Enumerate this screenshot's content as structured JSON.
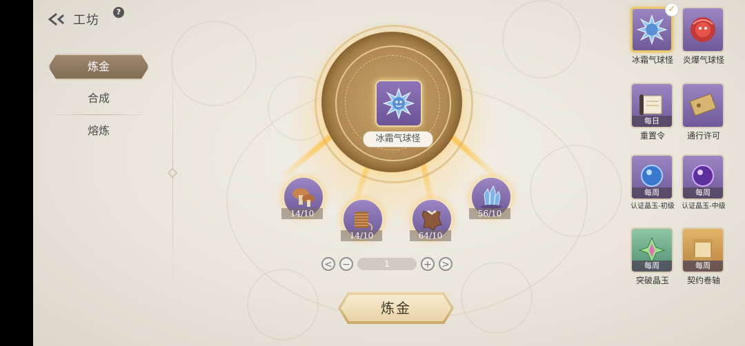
{
  "header": {
    "title": "工坊",
    "help_icon": "question-icon",
    "back_icon": "back-arrow-icon"
  },
  "menu": {
    "items": [
      {
        "label": "炼金",
        "active": true
      },
      {
        "label": "合成",
        "active": false
      },
      {
        "label": "熔炼",
        "active": false
      }
    ]
  },
  "recipe": {
    "target_label": "冰霜气球怪",
    "target_icon": "ice-balloon-monster-icon",
    "materials": [
      {
        "name": "mushroom-material",
        "count": "14/10"
      },
      {
        "name": "thread-spool-material",
        "count": "14/10"
      },
      {
        "name": "leather-hide-material",
        "count": "64/10"
      },
      {
        "name": "crystal-cluster-material",
        "count": "56/10"
      }
    ]
  },
  "quantity": {
    "value": "1",
    "prev": "<",
    "minus": "−",
    "plus": "+",
    "next": ">"
  },
  "craft_button": {
    "label": "炼金"
  },
  "side_items": [
    {
      "label": "冰霜气球怪",
      "tag": "",
      "icon": "ice-balloon-monster-icon",
      "selected": true
    },
    {
      "label": "炎爆气球怪",
      "tag": "",
      "icon": "fire-balloon-monster-icon",
      "selected": false
    },
    {
      "label": "重置令",
      "tag": "每日",
      "icon": "reset-scroll-icon",
      "selected": false
    },
    {
      "label": "通行许可",
      "tag": "",
      "icon": "pass-permit-icon",
      "selected": false
    },
    {
      "label": "认证晶玉-初级",
      "tag": "每周",
      "icon": "blue-orb-icon",
      "selected": false
    },
    {
      "label": "认证晶玉-中级",
      "tag": "每周",
      "icon": "purple-orb-icon",
      "selected": false
    },
    {
      "label": "突破晶玉",
      "tag": "每周",
      "icon": "breakthrough-crystal-icon",
      "selected": false
    },
    {
      "label": "契约卷轴",
      "tag": "每周",
      "icon": "contract-scroll-icon",
      "selected": false
    }
  ],
  "colors": {
    "accent_gold": "#e8c86c",
    "card_purple": "#8a73b6",
    "menu_active": "#8f7a62"
  }
}
